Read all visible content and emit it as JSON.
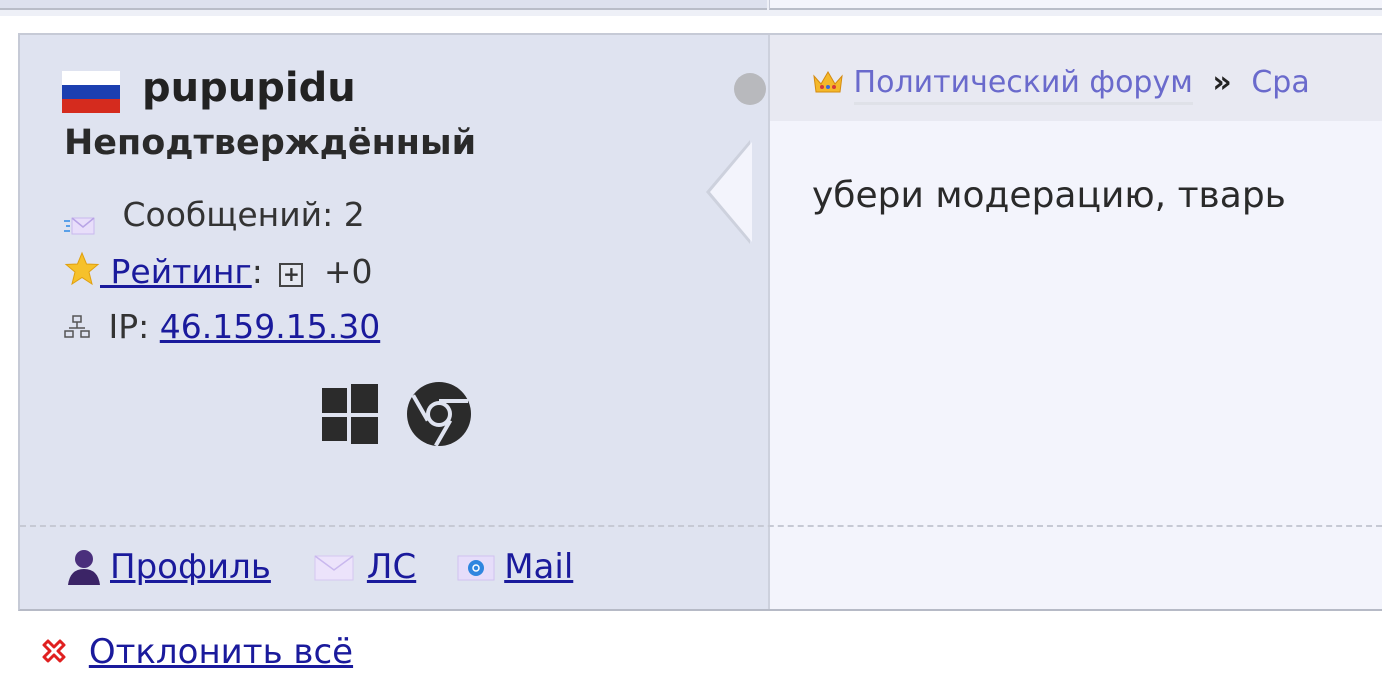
{
  "post": {
    "author": {
      "country_flag": "russia-flag-icon",
      "username": "pupupidu",
      "status": "Неподтверждённый",
      "online": false,
      "posts_label": "Сообщений:",
      "posts_count": "2",
      "rating_link": "Рейтинг",
      "rating_sep": ":",
      "rating_value": "+0",
      "ip_label": "IP:",
      "ip_value": "46.159.15.30",
      "os_icon": "windows-icon",
      "browser_icon": "chrome-icon"
    },
    "actions": {
      "profile": "Профиль",
      "pm": "ЛС",
      "mail": "Mail"
    },
    "breadcrumb": {
      "forum": "Политический форум",
      "separator": "»",
      "subforum_partial": "Сра"
    },
    "message": "убери модерацию, тварь"
  },
  "reject_all": "Отклонить всё",
  "colors": {
    "author_bg": "#dfe3f0",
    "content_bg": "#f3f4fc",
    "link": "#1a1a9c",
    "breadcrumb_link": "#6a6acc",
    "reject_red": "#e02020"
  }
}
